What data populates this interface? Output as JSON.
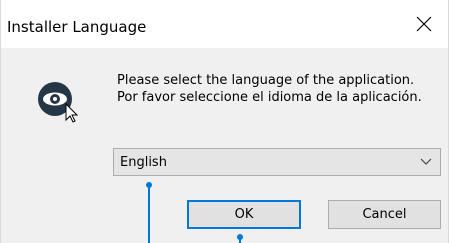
{
  "window": {
    "title": "Installer Language",
    "close_icon": "close-icon"
  },
  "content": {
    "app_icon": "eye-icon",
    "message": "Please select the language of the application. Por favor seleccione el idioma de la aplicación."
  },
  "language_select": {
    "selected_value": "English",
    "dropdown_icon": "chevron-down-icon"
  },
  "buttons": {
    "ok_label": "OK",
    "cancel_label": "Cancel"
  },
  "colors": {
    "accent": "#0078d7",
    "dialog_bg": "#f0f0f0",
    "titlebar_bg": "#ffffff",
    "icon_dark": "#253746"
  }
}
